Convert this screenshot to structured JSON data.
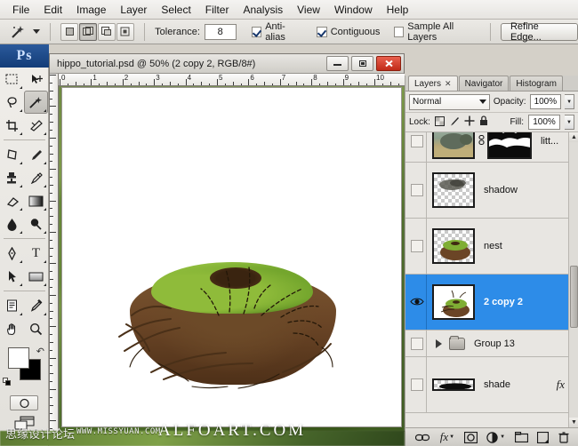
{
  "menu": {
    "items": [
      {
        "label": "File"
      },
      {
        "label": "Edit"
      },
      {
        "label": "Image"
      },
      {
        "label": "Layer"
      },
      {
        "label": "Select"
      },
      {
        "label": "Filter"
      },
      {
        "label": "Analysis"
      },
      {
        "label": "View"
      },
      {
        "label": "Window"
      },
      {
        "label": "Help"
      }
    ]
  },
  "options_bar": {
    "active_tool": "magic-wand-tool",
    "selection_modes": [
      {
        "name": "new-selection",
        "active": false
      },
      {
        "name": "add-to-selection",
        "active": true
      },
      {
        "name": "subtract-from-selection",
        "active": false
      },
      {
        "name": "intersect-with-selection",
        "active": false
      }
    ],
    "tolerance_label": "Tolerance:",
    "tolerance_value": "8",
    "anti_alias_label": "Anti-alias",
    "anti_alias_checked": true,
    "contiguous_label": "Contiguous",
    "contiguous_checked": true,
    "sample_all_layers_label": "Sample All Layers",
    "sample_all_layers_checked": false,
    "refine_edge_label": "Refine Edge..."
  },
  "toolbox": {
    "logo": "Ps",
    "tools": [
      {
        "name": "rectangular-marquee-tool",
        "glyph": "⬚"
      },
      {
        "name": "move-tool",
        "glyph": "➤"
      },
      {
        "name": "lasso-tool",
        "glyph": "○"
      },
      {
        "name": "magic-wand-tool",
        "glyph": "✳"
      },
      {
        "name": "crop-tool",
        "glyph": "⌗"
      },
      {
        "name": "slice-tool",
        "glyph": "✂"
      },
      {
        "name": "patch-tool",
        "glyph": "⬡"
      },
      {
        "name": "brush-tool",
        "glyph": "✎"
      },
      {
        "name": "clone-stamp-tool",
        "glyph": "♟"
      },
      {
        "name": "history-brush-tool",
        "glyph": "✐"
      },
      {
        "name": "eraser-tool",
        "glyph": "▱"
      },
      {
        "name": "gradient-tool",
        "glyph": "▣"
      },
      {
        "name": "blur-tool",
        "glyph": "●"
      },
      {
        "name": "dodge-tool",
        "glyph": "❂"
      },
      {
        "name": "pen-tool",
        "glyph": "✑"
      },
      {
        "name": "horizontal-type-tool",
        "glyph": "T"
      },
      {
        "name": "path-selection-tool",
        "glyph": "↖"
      },
      {
        "name": "rectangle-tool",
        "glyph": "▭"
      },
      {
        "name": "notes-tool",
        "glyph": "☰"
      },
      {
        "name": "eyedropper-tool",
        "glyph": "✒"
      },
      {
        "name": "hand-tool",
        "glyph": "✋"
      },
      {
        "name": "zoom-tool",
        "glyph": "⚲"
      }
    ],
    "foreground_color": "#ffffff",
    "background_color": "#000000",
    "quick_mask_name": "quick-mask-mode",
    "screen_mode_name": "screen-mode-toggle"
  },
  "document": {
    "title": "hippo_tutorial.psd @ 50% (2 copy 2, RGB/8#)",
    "zoom": "50%",
    "color_mode": "RGB/8#",
    "active_layer": "2 copy 2",
    "window_buttons": [
      {
        "name": "minimize-button",
        "glyph": "–"
      },
      {
        "name": "maximize-button",
        "glyph": "□"
      },
      {
        "name": "close-button",
        "glyph": "✕"
      }
    ],
    "ruler_units": "inches",
    "ruler_ticks": [
      "0",
      "1",
      "2",
      "3",
      "4",
      "5",
      "6",
      "7",
      "8",
      "9",
      "10"
    ]
  },
  "panel": {
    "tabs": [
      {
        "label": "Layers",
        "active": true,
        "closable": true
      },
      {
        "label": "Navigator",
        "active": false,
        "closable": false
      },
      {
        "label": "Histogram",
        "active": false,
        "closable": false
      }
    ],
    "blend_mode": "Normal",
    "opacity_label": "Opacity:",
    "opacity_value": "100%",
    "fill_label": "Fill:",
    "fill_value": "100%",
    "lock_label": "Lock:",
    "lock_icons": [
      {
        "name": "lock-transparent-pixels-icon",
        "glyph": "⬚"
      },
      {
        "name": "lock-image-pixels-icon",
        "glyph": "✎"
      },
      {
        "name": "lock-position-icon",
        "glyph": "✛"
      },
      {
        "name": "lock-all-icon",
        "glyph": "⚿"
      }
    ],
    "layers": [
      {
        "name": "litt...",
        "visible": false,
        "selected": false,
        "type": "image-with-mask",
        "has_mask": true,
        "linked": true
      },
      {
        "name": "shadow",
        "visible": false,
        "selected": false,
        "type": "image",
        "has_mask": false
      },
      {
        "name": "nest",
        "visible": false,
        "selected": false,
        "type": "image",
        "has_mask": false
      },
      {
        "name": "2 copy 2",
        "visible": true,
        "selected": true,
        "type": "image",
        "has_mask": false
      },
      {
        "name": "Group 13",
        "visible": false,
        "selected": false,
        "type": "group",
        "expanded": false
      },
      {
        "name": "shade",
        "visible": false,
        "selected": false,
        "type": "image",
        "has_effects": true,
        "effects_label": "fx"
      }
    ],
    "bottom_buttons": [
      {
        "name": "link-layers-button",
        "glyph": "⚭"
      },
      {
        "name": "layer-style-button",
        "glyph": "fx"
      },
      {
        "name": "add-layer-mask-button",
        "glyph": "□"
      },
      {
        "name": "new-adjustment-layer-button",
        "glyph": "◑"
      },
      {
        "name": "new-group-button",
        "glyph": "⬜"
      },
      {
        "name": "new-layer-button",
        "glyph": "⧉"
      },
      {
        "name": "delete-layer-button",
        "glyph": "Ὕ1"
      }
    ],
    "scrollbar": {
      "up_glyph": "▲",
      "down_glyph": "▼"
    },
    "accent_color": "#2d8ce8"
  },
  "watermarks": {
    "forum_cn": "思缘设计论坛",
    "forum_url": "WWW.MISSYUAN.COM",
    "site": "ALFOART.COM"
  }
}
